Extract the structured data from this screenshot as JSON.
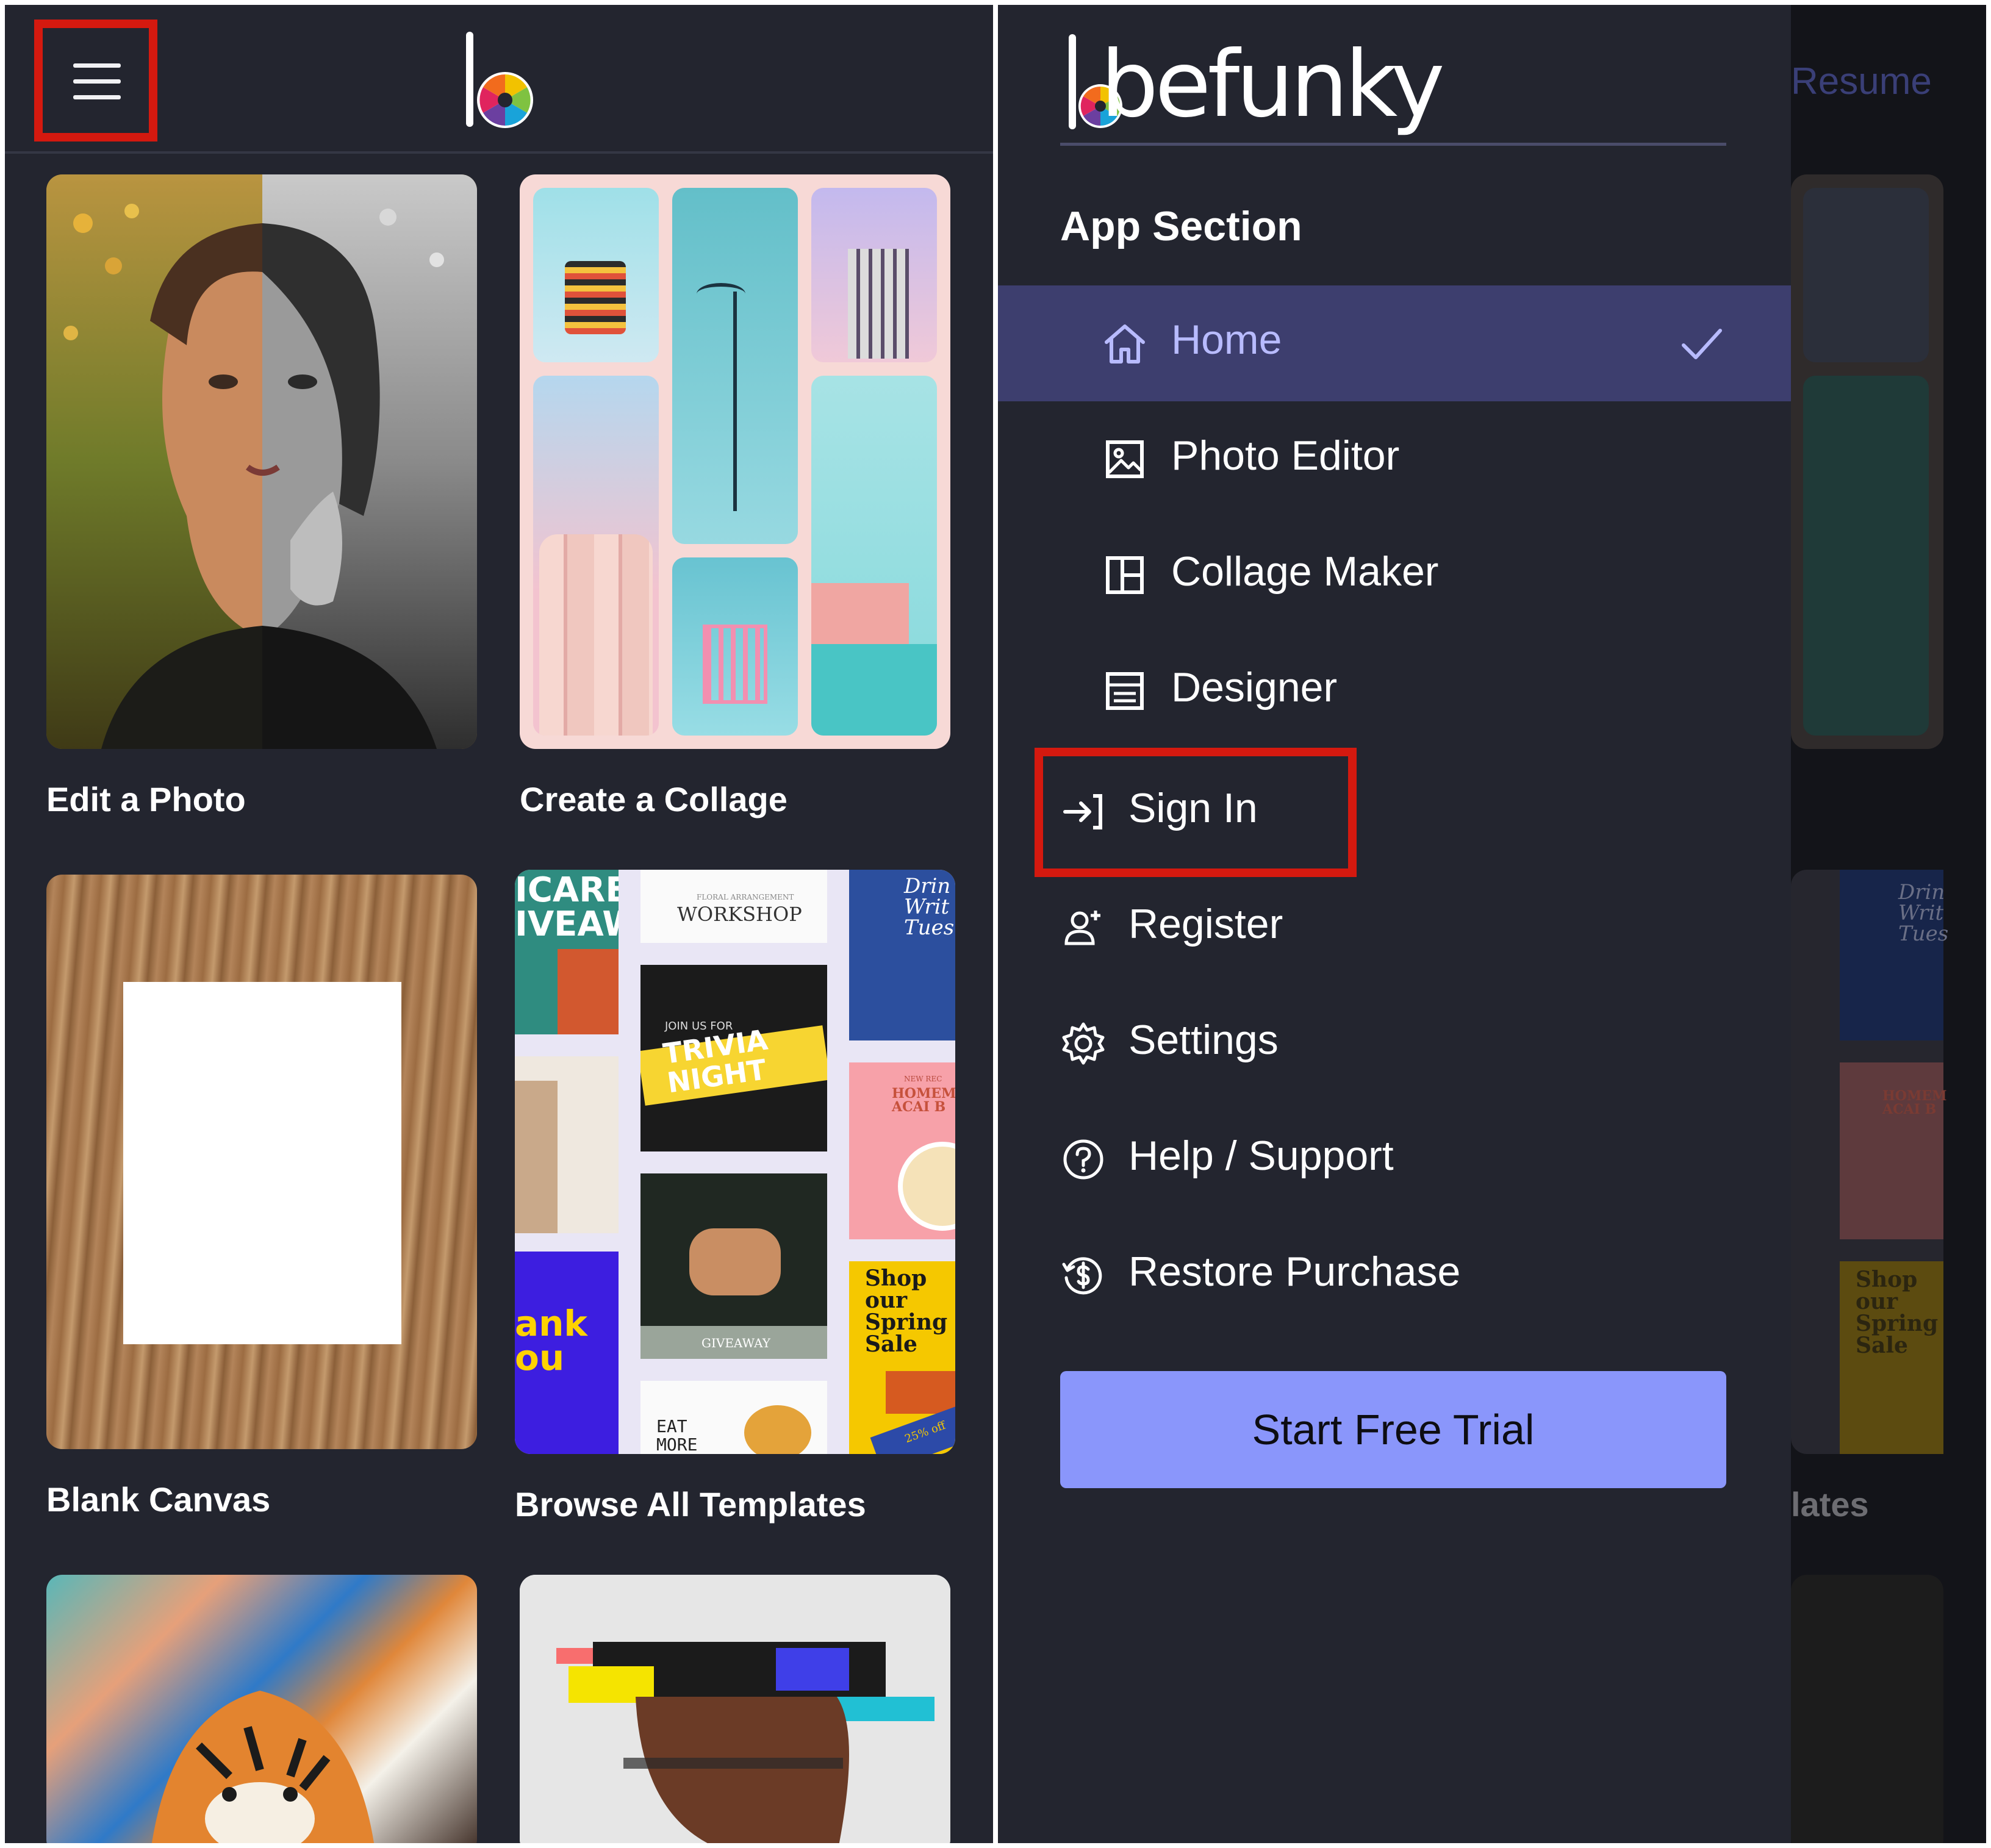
{
  "home_screen": {
    "cards": [
      {
        "label": "Edit a Photo"
      },
      {
        "label": "Create a Collage"
      },
      {
        "label": "Blank Canvas"
      },
      {
        "label": "Browse All Templates"
      }
    ],
    "template_thumbs": {
      "careaway": "ICARE\nIVEAWAY",
      "workshop": "WORKSHOP",
      "workshop_small": "FLORAL ARRANGEMENT",
      "trivia": "TRIVIA\nNIGHT",
      "join": "JOIN US FOR",
      "drink": "Drin\nWrit\nTues",
      "homemade": "HOMEM\nACAI B",
      "new_rec": "NEW REC",
      "thank": "ank\nou",
      "giveaway": "GIVEAWAY",
      "shop": "Shop\nour\nSpring\nSale",
      "eat": "EAT\nMORE",
      "discount": "25% off"
    }
  },
  "drawer": {
    "brand": "befunky",
    "section_title": "App Section",
    "items": [
      {
        "label": "Home",
        "icon": "home-icon",
        "active": true
      },
      {
        "label": "Photo Editor",
        "icon": "image-icon"
      },
      {
        "label": "Collage Maker",
        "icon": "collage-icon"
      },
      {
        "label": "Designer",
        "icon": "designer-icon"
      },
      {
        "label": "Sign In",
        "icon": "sign-in-icon"
      },
      {
        "label": "Register",
        "icon": "register-icon"
      },
      {
        "label": "Settings",
        "icon": "gear-icon"
      },
      {
        "label": "Help / Support",
        "icon": "help-icon"
      },
      {
        "label": "Restore Purchase",
        "icon": "restore-purchase-icon"
      }
    ],
    "cta": "Start Free Trial"
  },
  "background_peek": {
    "resume": "Resume",
    "label_fragment": "lates",
    "drink": "Drin\nWrit\nTues",
    "homemade": "HOMEM\nACAI B",
    "shop": "Shop\nour\nSpring\nSale"
  },
  "colors": {
    "background": "#23252f",
    "highlight_box": "#d4190f",
    "active_item": "#3d3e6e",
    "active_text": "#b8bbff",
    "cta": "#8a96fb"
  }
}
